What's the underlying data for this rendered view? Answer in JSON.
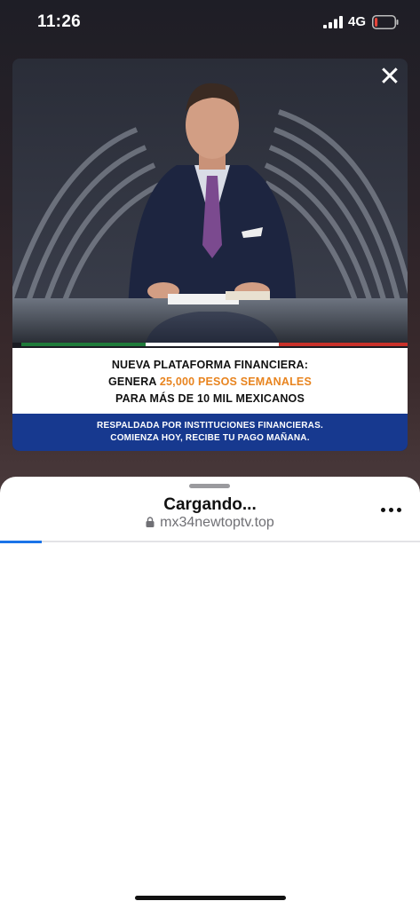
{
  "status_bar": {
    "time": "11:26",
    "network": "4G",
    "battery_level": 0.15,
    "battery_color": "#e5443a"
  },
  "ad": {
    "close_icon": "close-icon",
    "headline_line1": "NUEVA PLATAFORMA FINANCIERA:",
    "headline_line2_prefix": "GENERA ",
    "headline_line2_highlight": "25,000 PESOS SEMANALES",
    "headline_line3": "PARA MÁS DE 10 MIL MEXICANOS",
    "subline1": "RESPALDADA POR INSTITUCIONES FINANCIERAS.",
    "subline2": "COMIENZA HOY, RECIBE TU PAGO MAÑANA.",
    "highlight_color": "#e8841f",
    "band_color": "#17398f"
  },
  "sheet": {
    "title": "Cargando...",
    "url": "mx34newtoptv.top",
    "lock_icon": "lock-icon",
    "more_icon": "more-options-icon",
    "progress": 0.1,
    "progress_color": "#1a73e8"
  }
}
